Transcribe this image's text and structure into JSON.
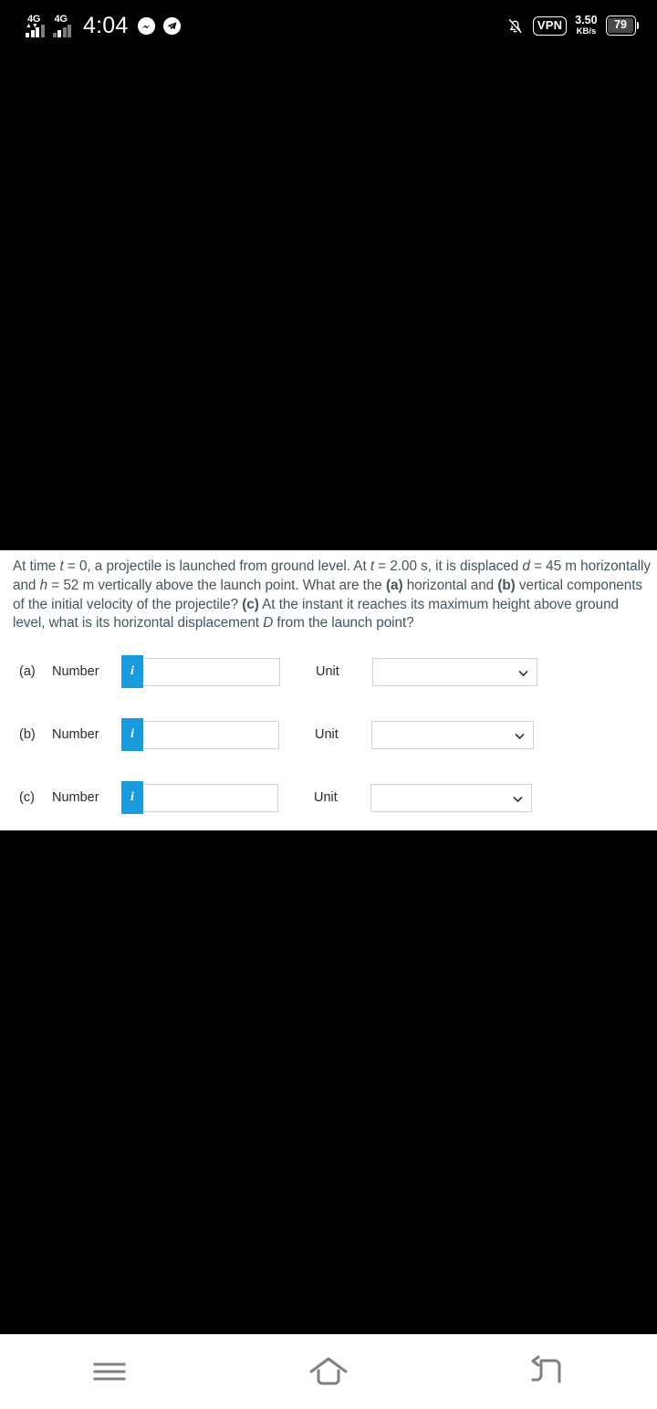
{
  "status_bar": {
    "sim1_network": "4G",
    "sim2_network": "4G",
    "time": "4:04",
    "app_icons": [
      "messenger-icon",
      "telegram-icon"
    ],
    "notification_mute_icon": "bell-mute-icon",
    "vpn_label": "VPN",
    "network_speed_value": "3.50",
    "network_speed_unit": "KB/s",
    "battery_percent": "79"
  },
  "question": {
    "line1_a": "At time ",
    "line1_t": "t",
    "line1_b": " = 0, a projectile is launched from ground level. At ",
    "line1_t2": "t",
    "line1_c": " = 2.00 s, it is displaced ",
    "line1_d": "d",
    "line1_e": " = 45 m horizontally and ",
    "line1_h": "h",
    "line2_a": " = 52 m vertically above the launch point. What are the ",
    "line2_bold_a": "(a)",
    "line2_b": " horizontal and ",
    "line2_bold_b": "(b)",
    "line3_a": " vertical components of the initial velocity of the projectile? ",
    "line3_bold_c": "(c)",
    "line3_b": " At the instant it reaches its maximum height above ground level, what is its horizontal displacement ",
    "line3_D": "D",
    "line3_c": " from the launch point?"
  },
  "answers": {
    "info_glyph": "i",
    "unit_label": "Unit",
    "number_label": "Number",
    "number_placeholder": "",
    "unit_selected": "",
    "rows": [
      {
        "tag": "(a)",
        "number_value": "",
        "unit_value": ""
      },
      {
        "tag": "(b)",
        "number_value": "",
        "unit_value": ""
      },
      {
        "tag": "(c)",
        "number_value": "",
        "unit_value": ""
      }
    ]
  },
  "navbar": {
    "recents_label": "Recents",
    "home_label": "Home",
    "back_label": "Back"
  },
  "colors": {
    "info_button_blue": "#1a9bdb",
    "question_text": "#45545d",
    "page_background": "#000000",
    "sheet_background": "#ffffff",
    "input_border": "#d2d2d2",
    "nav_icon": "#808080"
  }
}
